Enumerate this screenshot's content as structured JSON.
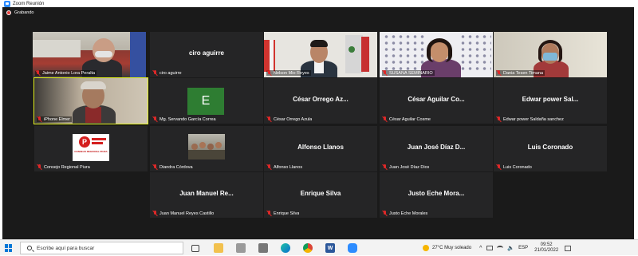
{
  "window": {
    "title": "Zoom Reunión"
  },
  "recording": {
    "label": "Grabando"
  },
  "participants": [
    {
      "name": "Jaime Antonio Lora Peralta",
      "muted": true
    },
    {
      "name": "ciro aguirre",
      "display": "ciro aguirre",
      "muted": true
    },
    {
      "name": "Nelson Mio Reyes",
      "muted": true
    },
    {
      "name": "SUSANA SEMINARIO",
      "muted": true
    },
    {
      "name": "Dania Tesen Timana",
      "muted": true
    },
    {
      "name": "iPhone Elmer",
      "muted": true,
      "active_speaker": true
    },
    {
      "name": "Mg. Servando García Correa",
      "avatar_letter": "E",
      "avatar_color": "#2e7d32",
      "muted": true
    },
    {
      "name": "César Orrego Azula",
      "display": "César Orrego Az...",
      "muted": true
    },
    {
      "name": "César Aguilar Cosme",
      "display": "César Aguilar Co...",
      "muted": true
    },
    {
      "name": "Edwar power Saldaña sanchez",
      "display": "Edwar power Sal...",
      "muted": true
    },
    {
      "name": "Consejo Regional Piura",
      "logo_text": "CONSEJO REGIONAL PIURA",
      "muted": true
    },
    {
      "name": "Diandra Córdova",
      "muted": true
    },
    {
      "name": "Alfonso Llanos",
      "display": "Alfonso Llanos",
      "muted": true
    },
    {
      "name": "Juan José Díaz Dios",
      "display": "Juan José Díaz D...",
      "muted": true
    },
    {
      "name": "Luis Coronado",
      "display": "Luis Coronado",
      "muted": true
    },
    {
      "name": "Juan Manuel Reyes Castillo",
      "display": "Juan Manuel Re...",
      "muted": true
    },
    {
      "name": "Enrique Silva",
      "display": "Enrique Silva",
      "muted": true
    },
    {
      "name": "Justo Eche Morales",
      "display": "Justo Eche Mora...",
      "muted": true
    }
  ],
  "taskbar": {
    "search_placeholder": "Escribe aquí para buscar",
    "apps": [
      "task-view",
      "file-explorer",
      "edge",
      "chrome",
      "word",
      "store",
      "zoom",
      "mail"
    ],
    "weather": "27°C  Muy soleado",
    "language": "ESP",
    "time": "09:52",
    "date": "21/01/2022"
  }
}
